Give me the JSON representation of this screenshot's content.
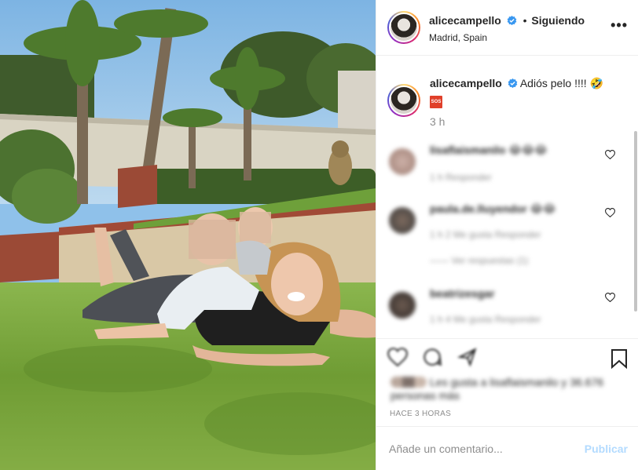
{
  "header": {
    "username": "alicecampello",
    "separator": "•",
    "following_label": "Siguiendo",
    "location": "Madrid, Spain",
    "more_icon": "•••"
  },
  "caption": {
    "username": "alicecampello",
    "text": "Adiós pelo !!!! 🤣",
    "badge": "SOS",
    "time": "3 h"
  },
  "comments": [
    {
      "user": "lisaflaismanilo",
      "text": "😂😂😂",
      "meta": "1 h   Responder"
    },
    {
      "user": "paula.de.lluyendor",
      "text": "😂😂",
      "meta": "1 h   2 Me gusta   Responder",
      "replies": "—— Ver respuestas (1)"
    },
    {
      "user": "beatrizesgar",
      "text": "",
      "meta": "1 h   4 Me gusta   Responder"
    }
  ],
  "likes": {
    "text": "Les gusta a lisaflaismanilo y 36.676 personas más"
  },
  "timeago": "HACE 3 HORAS",
  "add_comment": {
    "placeholder": "Añade un comentario...",
    "publish_label": "Publicar"
  },
  "colors": {
    "text": "#262626",
    "secondary": "#8e8e8e",
    "verified": "#3897f0",
    "publish_disabled": "#b3dbff",
    "border": "#efefef"
  },
  "icons": [
    "verified-badge-icon",
    "more-options-icon",
    "heart-icon",
    "comment-icon",
    "share-icon",
    "bookmark-icon"
  ]
}
